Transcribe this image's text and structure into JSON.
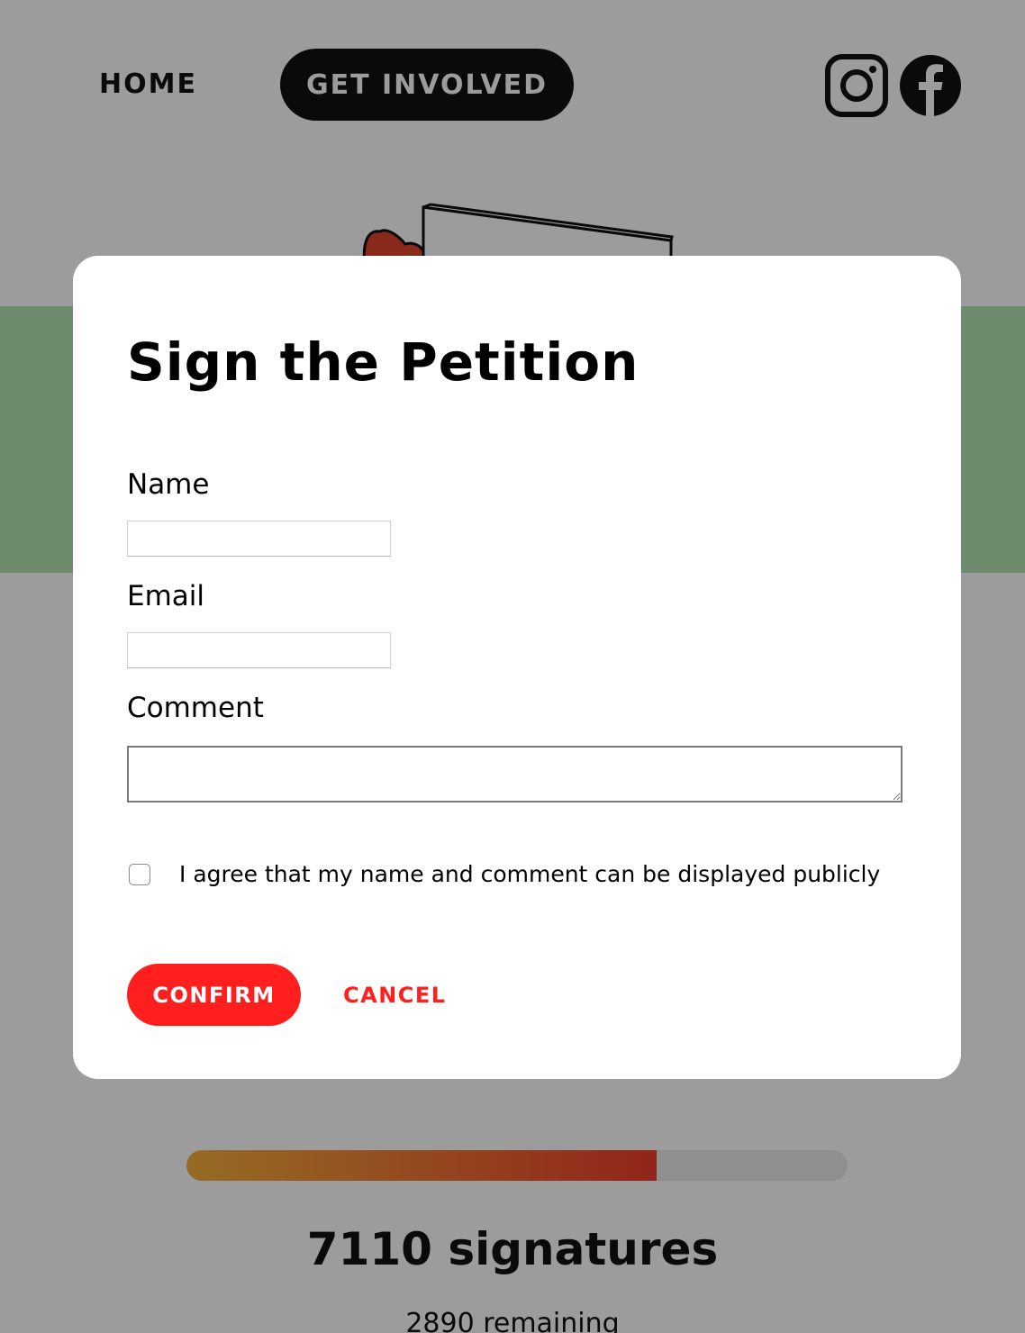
{
  "nav": {
    "home_label": "HOME",
    "get_involved_label": "GET INVOLVED"
  },
  "social": {
    "instagram_icon": "instagram-icon",
    "facebook_icon": "facebook-icon"
  },
  "colors": {
    "accent_red": "#ff1f1f",
    "nav_dark": "#111111",
    "band_green": "#b6e4b3",
    "progress_start": "#f4b23c",
    "progress_end": "#f03c2b"
  },
  "petition": {
    "signatures_text": "7110 signatures",
    "remaining_text": "2890 remaining",
    "progress_fraction": 0.711
  },
  "modal": {
    "title": "Sign the Petition",
    "name_label": "Name",
    "name_value": "",
    "email_label": "Email",
    "email_value": "",
    "comment_label": "Comment",
    "comment_value": "",
    "agree_text": "I agree that my name and comment can be displayed publicly",
    "agree_checked": false,
    "confirm_label": "CONFIRM",
    "cancel_label": "CANCEL"
  }
}
